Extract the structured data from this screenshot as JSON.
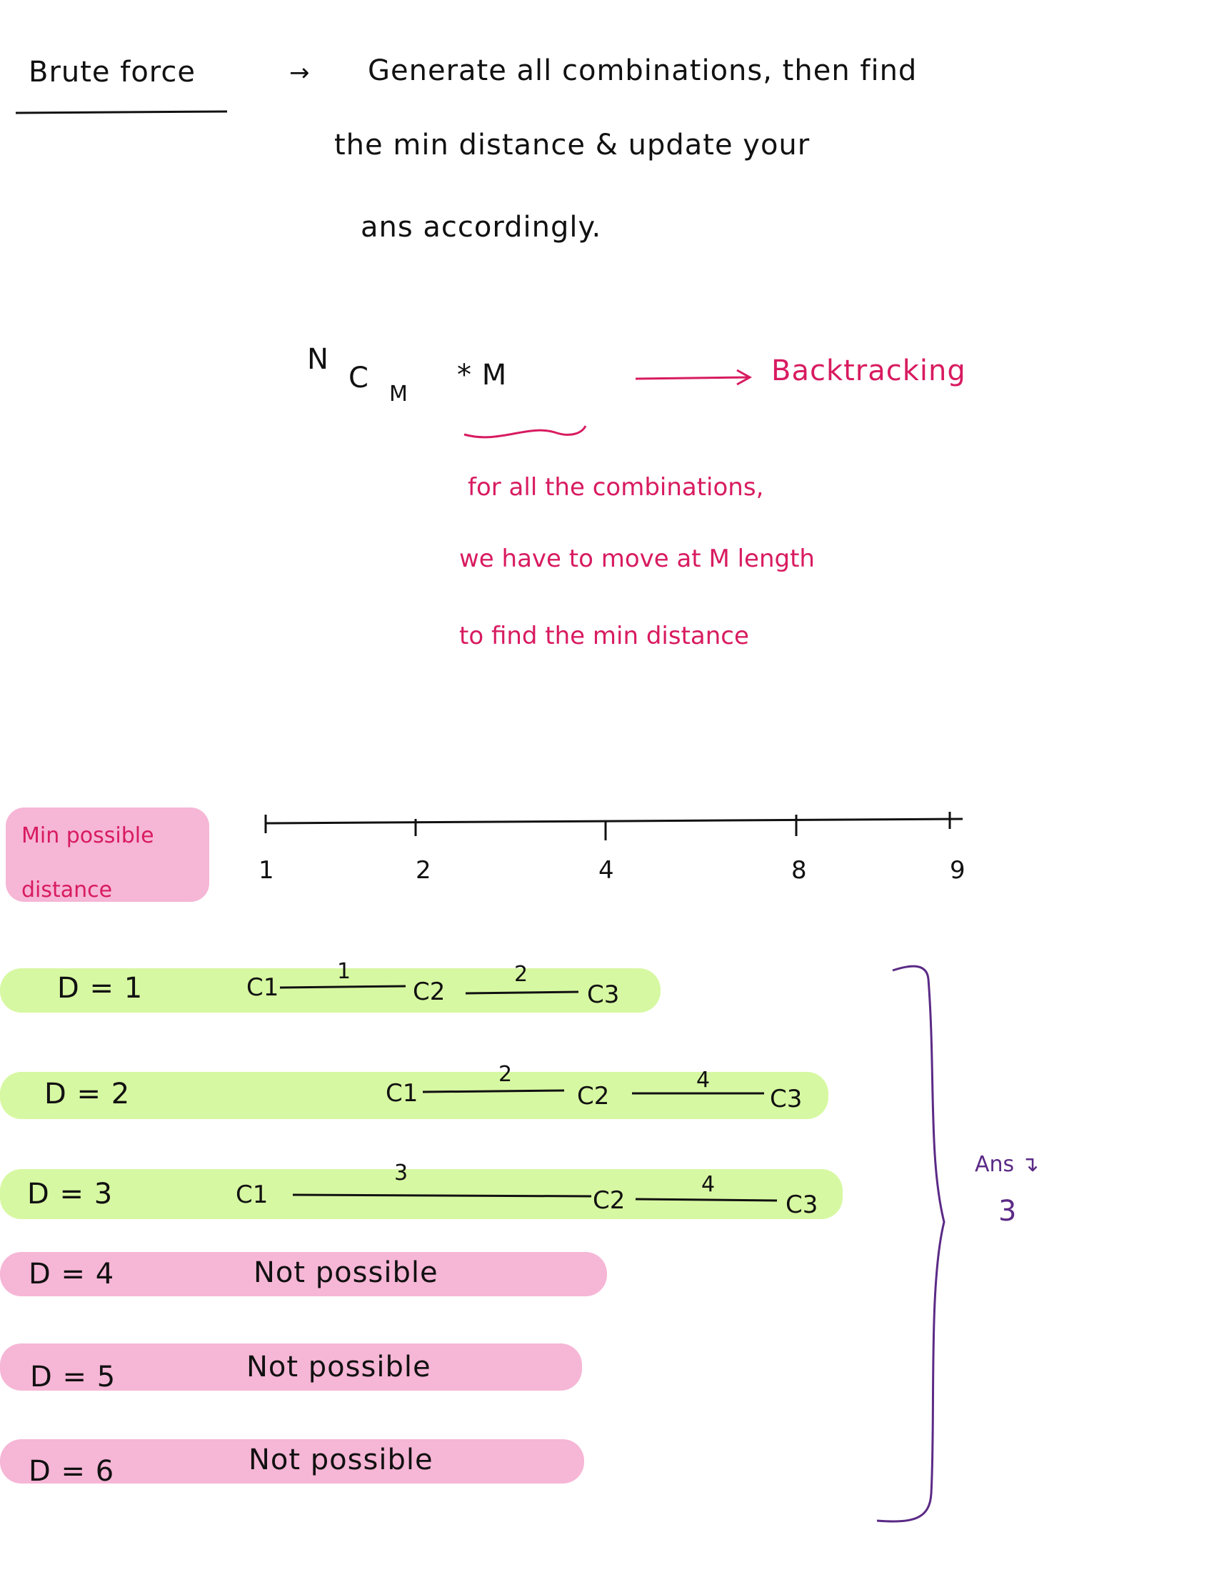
{
  "colors": {
    "pink_ink": "#d81b60",
    "purple_ink": "#5b2a86",
    "green_highlight": "#d7f8a2",
    "pink_highlight": "#f6b6d6"
  },
  "top": {
    "heading": "Brute force",
    "arrow": "→",
    "line1": "Generate all combinations, then find",
    "line2": "the min distance & update your",
    "line3": "ans accordingly."
  },
  "formula": {
    "n": "N",
    "c": "C",
    "m_sub": "M",
    "times_m": "* M",
    "arrow_label": "Backtracking",
    "note1": "for all the combinations,",
    "note2": "we have to move at M length",
    "note3": "to find the min distance"
  },
  "number_line": {
    "label_line1": "Min possible",
    "label_line2": "distance",
    "ticks": [
      "1",
      "2",
      "4",
      "8",
      "9"
    ]
  },
  "rows": [
    {
      "d": "D = 1",
      "c1": "C1",
      "gap1": "1",
      "c2": "C2",
      "gap2": "2",
      "c3": "C3"
    },
    {
      "d": "D = 2",
      "c1": "C1",
      "gap1": "2",
      "c2": "C2",
      "gap2": "4",
      "c3": "C3"
    },
    {
      "d": "D = 3",
      "c1": "C1",
      "gap1": "3",
      "c2": "C2",
      "gap2": "4",
      "c3": "C3"
    },
    {
      "d": "D = 4",
      "status": "Not possible"
    },
    {
      "d": "D = 5",
      "status": "Not possible"
    },
    {
      "d": "D = 6",
      "status": "Not possible"
    }
  ],
  "answer": {
    "label": "Ans ↴",
    "value": "3"
  }
}
